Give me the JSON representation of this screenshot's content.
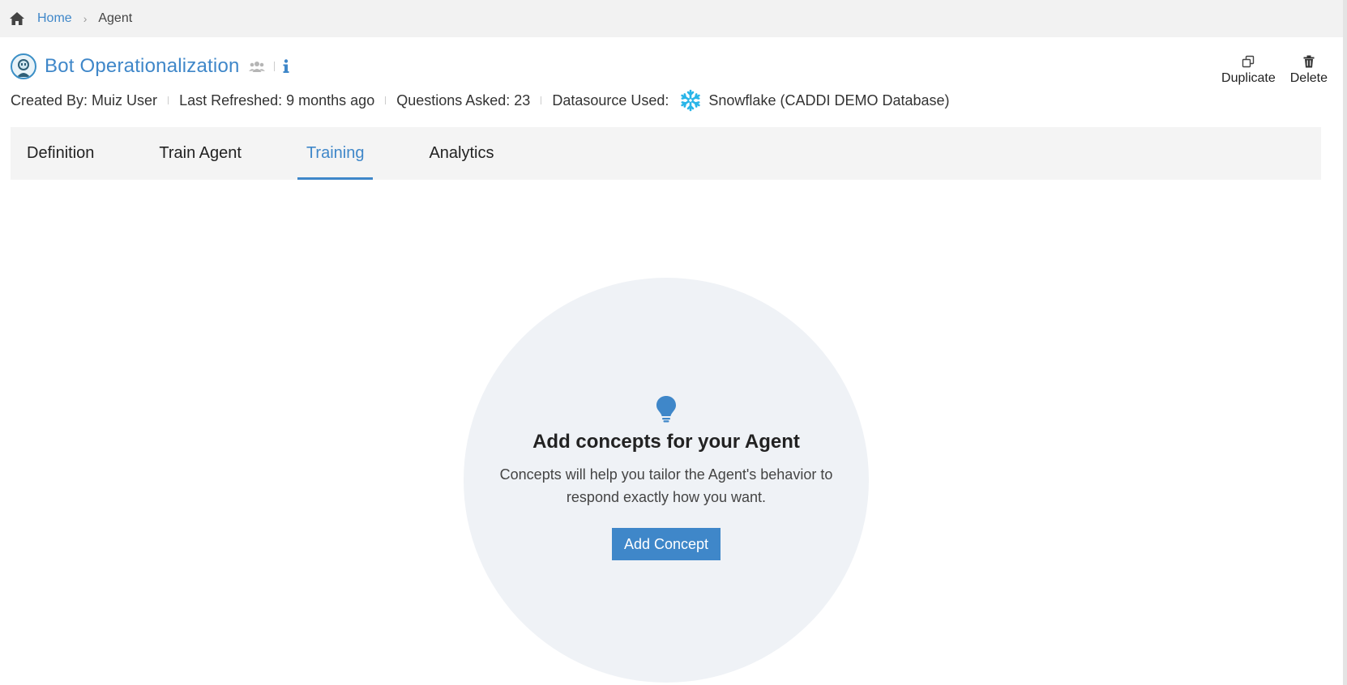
{
  "breadcrumb": {
    "home_label": "Home",
    "separator": "›",
    "current": "Agent"
  },
  "header": {
    "title": "Bot Operationalization"
  },
  "meta": {
    "created_by": "Created By: Muiz User",
    "last_refreshed": "Last Refreshed: 9 months ago",
    "questions_asked": "Questions Asked: 23",
    "datasource_label": "Datasource Used:",
    "datasource_name": "Snowflake (CADDI DEMO Database)"
  },
  "actions": {
    "duplicate_label": "Duplicate",
    "delete_label": "Delete"
  },
  "tabs": [
    {
      "label": "Definition",
      "active": false
    },
    {
      "label": "Train Agent",
      "active": false
    },
    {
      "label": "Training",
      "active": true
    },
    {
      "label": "Analytics",
      "active": false
    }
  ],
  "empty_state": {
    "title": "Add concepts for your Agent",
    "description": "Concepts will help you tailor the Agent's behavior to respond exactly how you want.",
    "button_label": "Add Concept"
  },
  "icons": {
    "home": "home-icon",
    "users": "users-icon",
    "info": "info-icon",
    "snowflake": "snowflake-icon",
    "duplicate": "duplicate-icon",
    "delete": "trash-icon",
    "bulb": "lightbulb-icon"
  },
  "colors": {
    "accent": "#3f87c9",
    "snowflake": "#29b5e8",
    "empty_circle": "#eff2f6",
    "tab_bar": "#f4f4f4"
  }
}
